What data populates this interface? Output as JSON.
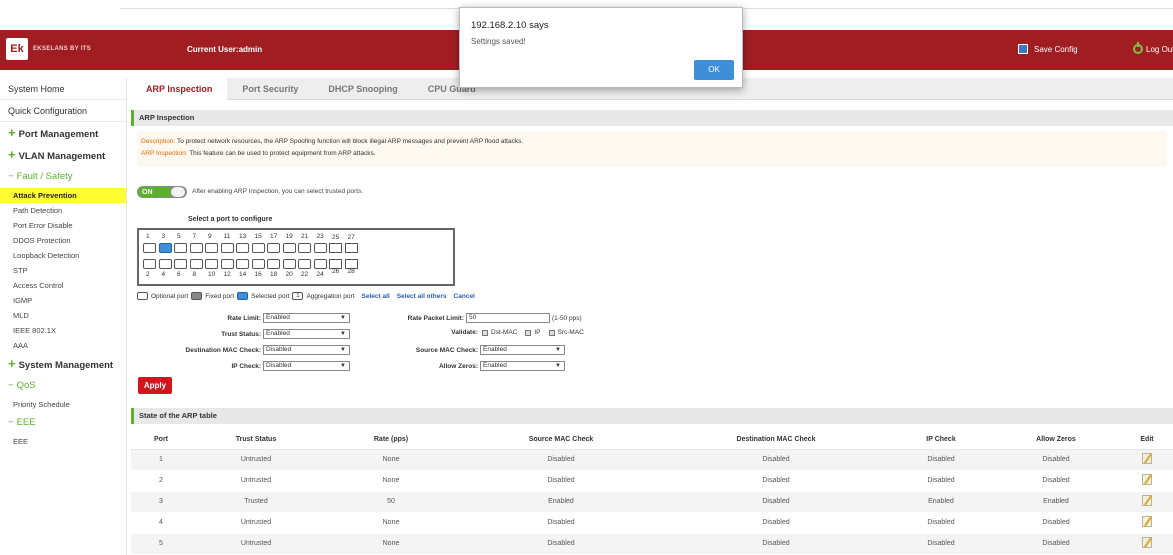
{
  "header": {
    "logo_abbr": "Ek",
    "logo_text": "EKSELANS BY ITS",
    "current_user": "Current User:admin",
    "save_config": "Save Config",
    "logout": "Log Out"
  },
  "sidebar": {
    "items": [
      "System Home",
      "Quick Configuration"
    ],
    "port_management": "Port Management",
    "vlan_management": "VLAN Management",
    "fault_safety": "Fault / Safety",
    "fault_safety_sub": [
      "Attack Prevention",
      "Path Detection",
      "Port Error Disable",
      "DDOS Protection",
      "Loopback Detection",
      "STP",
      "Access Control",
      "IGMP",
      "MLD",
      "IEEE 802.1X",
      "AAA"
    ],
    "system_management": "System Management",
    "qos": "QoS",
    "qos_sub": [
      "Priority Schedule"
    ],
    "eee": "EEE",
    "eee_sub": [
      "EEE"
    ]
  },
  "tabs": [
    "ARP Inspection",
    "Port Security",
    "DHCP Snooping",
    "CPU Guard"
  ],
  "section": {
    "arp_inspection": "ARP Inspection",
    "arp_table": "State of the ARP table"
  },
  "description": {
    "label1": "Description:",
    "text1": " To protect network resources, the ARP Spoofing function will block illegal ARP messages and prevent ARP flood attacks.",
    "label2": "ARP Inspection:",
    "text2": " This feature can be used to protect equipment from ARP attacks."
  },
  "toggle": {
    "state": "ON",
    "text": "After enabling ARP Inspection, you can select trusted ports."
  },
  "ports": {
    "title": "Select a port to configure",
    "top_numbers": [
      "1",
      "3",
      "5",
      "7",
      "9",
      "11",
      "13",
      "15",
      "17",
      "19",
      "21",
      "23",
      "25",
      "27"
    ],
    "bottom_numbers": [
      "2",
      "4",
      "6",
      "8",
      "10",
      "12",
      "14",
      "16",
      "18",
      "20",
      "22",
      "24",
      "26",
      "28"
    ],
    "selected_port": "3"
  },
  "legend": {
    "optional": "Optional port",
    "fixed": "Fixed port",
    "selected": "Selected port",
    "aggregation_num": "1",
    "aggregation": "Aggregation port",
    "select_all": "Select all",
    "select_others": "Select all others",
    "cancel": "Cancel"
  },
  "form": {
    "rate_limit_label": "Rate Limit:",
    "rate_limit_value": "Enabled",
    "trust_status_label": "Trust Status:",
    "trust_status_value": "Enabled",
    "dest_mac_label": "Destination MAC Check:",
    "dest_mac_value": "Disabled",
    "ip_check_label": "IP Check:",
    "ip_check_value": "Disabled",
    "rate_packet_label": "Rate Packet Limit:",
    "rate_packet_value": "50",
    "rate_packet_hint": "(1-50 pps)",
    "validate_label": "Validate:",
    "validate_dst": "Dst-MAC",
    "validate_ip": "IP",
    "validate_src": "Src-MAC",
    "src_mac_label": "Source MAC Check:",
    "src_mac_value": "Enabled",
    "allow_zeros_label": "Allow Zeros:",
    "allow_zeros_value": "Enabled",
    "apply": "Apply"
  },
  "table": {
    "headers": [
      "Port",
      "Trust Status",
      "Rate (pps)",
      "Source MAC Check",
      "Destination MAC Check",
      "IP Check",
      "Allow Zeros",
      "Edit"
    ],
    "rows": [
      [
        "1",
        "Untrusted",
        "None",
        "Disabled",
        "Disabled",
        "Disabled",
        "Disabled"
      ],
      [
        "2",
        "Untrusted",
        "None",
        "Disabled",
        "Disabled",
        "Disabled",
        "Disabled"
      ],
      [
        "3",
        "Trusted",
        "50",
        "Enabled",
        "Disabled",
        "Enabled",
        "Enabled"
      ],
      [
        "4",
        "Untrusted",
        "None",
        "Disabled",
        "Disabled",
        "Disabled",
        "Disabled"
      ],
      [
        "5",
        "Untrusted",
        "None",
        "Disabled",
        "Disabled",
        "Disabled",
        "Disabled"
      ]
    ]
  },
  "dialog": {
    "title": "192.168.2.10 says",
    "message": "Settings saved!",
    "ok": "OK"
  },
  "colors": {
    "brand_red": "#a01e22",
    "accent_green": "#5cb030",
    "highlight_yellow": "#ffff33",
    "link_blue": "#2a5db0"
  }
}
